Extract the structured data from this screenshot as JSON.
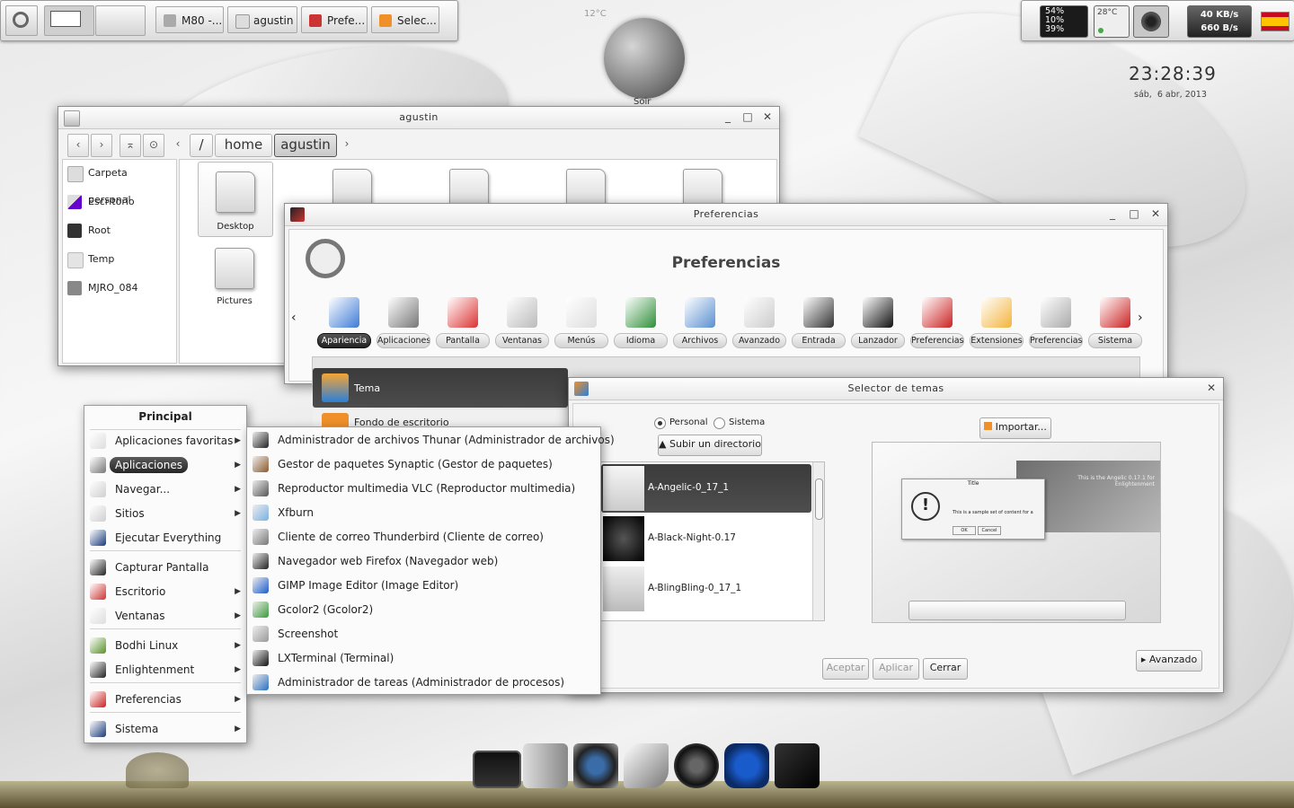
{
  "top_panel": {
    "tasks": [
      "M80 -...",
      "agustin",
      "Prefe...",
      "Selec..."
    ],
    "cpu_gadget": [
      "54%",
      "10%",
      "39%"
    ],
    "temp_gadget": "28°C",
    "net_down": "40 KB/s",
    "net_up": "660 B/s"
  },
  "moon_widget": {
    "temp": "12°C",
    "label": "Soir"
  },
  "clock": {
    "time": "23:28:39",
    "date": "sáb,  6 abr, 2013"
  },
  "file_manager": {
    "title": "agustin",
    "path": [
      "/",
      "home",
      "agustin"
    ],
    "places": [
      "Carpeta personal",
      "Escritorio",
      "Root",
      "Temp",
      "MJRO_084"
    ],
    "folders": [
      "Desktop",
      "Pictures"
    ]
  },
  "preferences": {
    "title": "Preferencias",
    "heading": "Preferencias",
    "categories": [
      "Apariencia",
      "Aplicaciones",
      "Pantalla",
      "Ventanas",
      "Menús",
      "Idioma",
      "Archivos",
      "Avanzado",
      "Entrada",
      "Lanzador",
      "Preferencias",
      "Extensiones",
      "Preferencias",
      "Sistema"
    ],
    "items": [
      "Tema",
      "Fondo de escritorio"
    ]
  },
  "main_menu": {
    "title": "Principal",
    "items": [
      "Aplicaciones favoritas",
      "Aplicaciones",
      "Navegar...",
      "Sitios",
      "Ejecutar Everything",
      "Capturar Pantalla",
      "Escritorio",
      "Ventanas",
      "Bodhi Linux",
      "Enlightenment",
      "Preferencias",
      "Sistema"
    ]
  },
  "apps_menu": {
    "items": [
      "Administrador de archivos Thunar (Administrador de archivos)",
      "Gestor de paquetes Synaptic (Gestor de paquetes)",
      "Reproductor multimedia VLC (Reproductor multimedia)",
      "Xfburn",
      "Cliente de correo Thunderbird (Cliente de correo)",
      "Navegador web Firefox (Navegador web)",
      "GIMP Image Editor (Image Editor)",
      "Gcolor2 (Gcolor2)",
      "Screenshot",
      "LXTerminal (Terminal)",
      "Administrador de tareas (Administrador de procesos)"
    ]
  },
  "theme_selector": {
    "title": "Selector de temas",
    "radio_personal": "Personal",
    "radio_system": "Sistema",
    "up_dir": "Subir un directorio",
    "import": "Importar...",
    "themes": [
      "A-Angelic-0_17_1",
      "A-Black-Night-0.17",
      "A-BlingBling-0_17_1"
    ],
    "preview_title": "Title",
    "preview_text": "This is a sample set of content for a",
    "preview_ok": "OK",
    "preview_cancel": "Cancel",
    "preview_caption": "This is the Angelic 0.17.1 for Enlightenment",
    "advanced": "Avanzado",
    "accept": "Aceptar",
    "apply": "Aplicar",
    "close": "Cerrar"
  }
}
